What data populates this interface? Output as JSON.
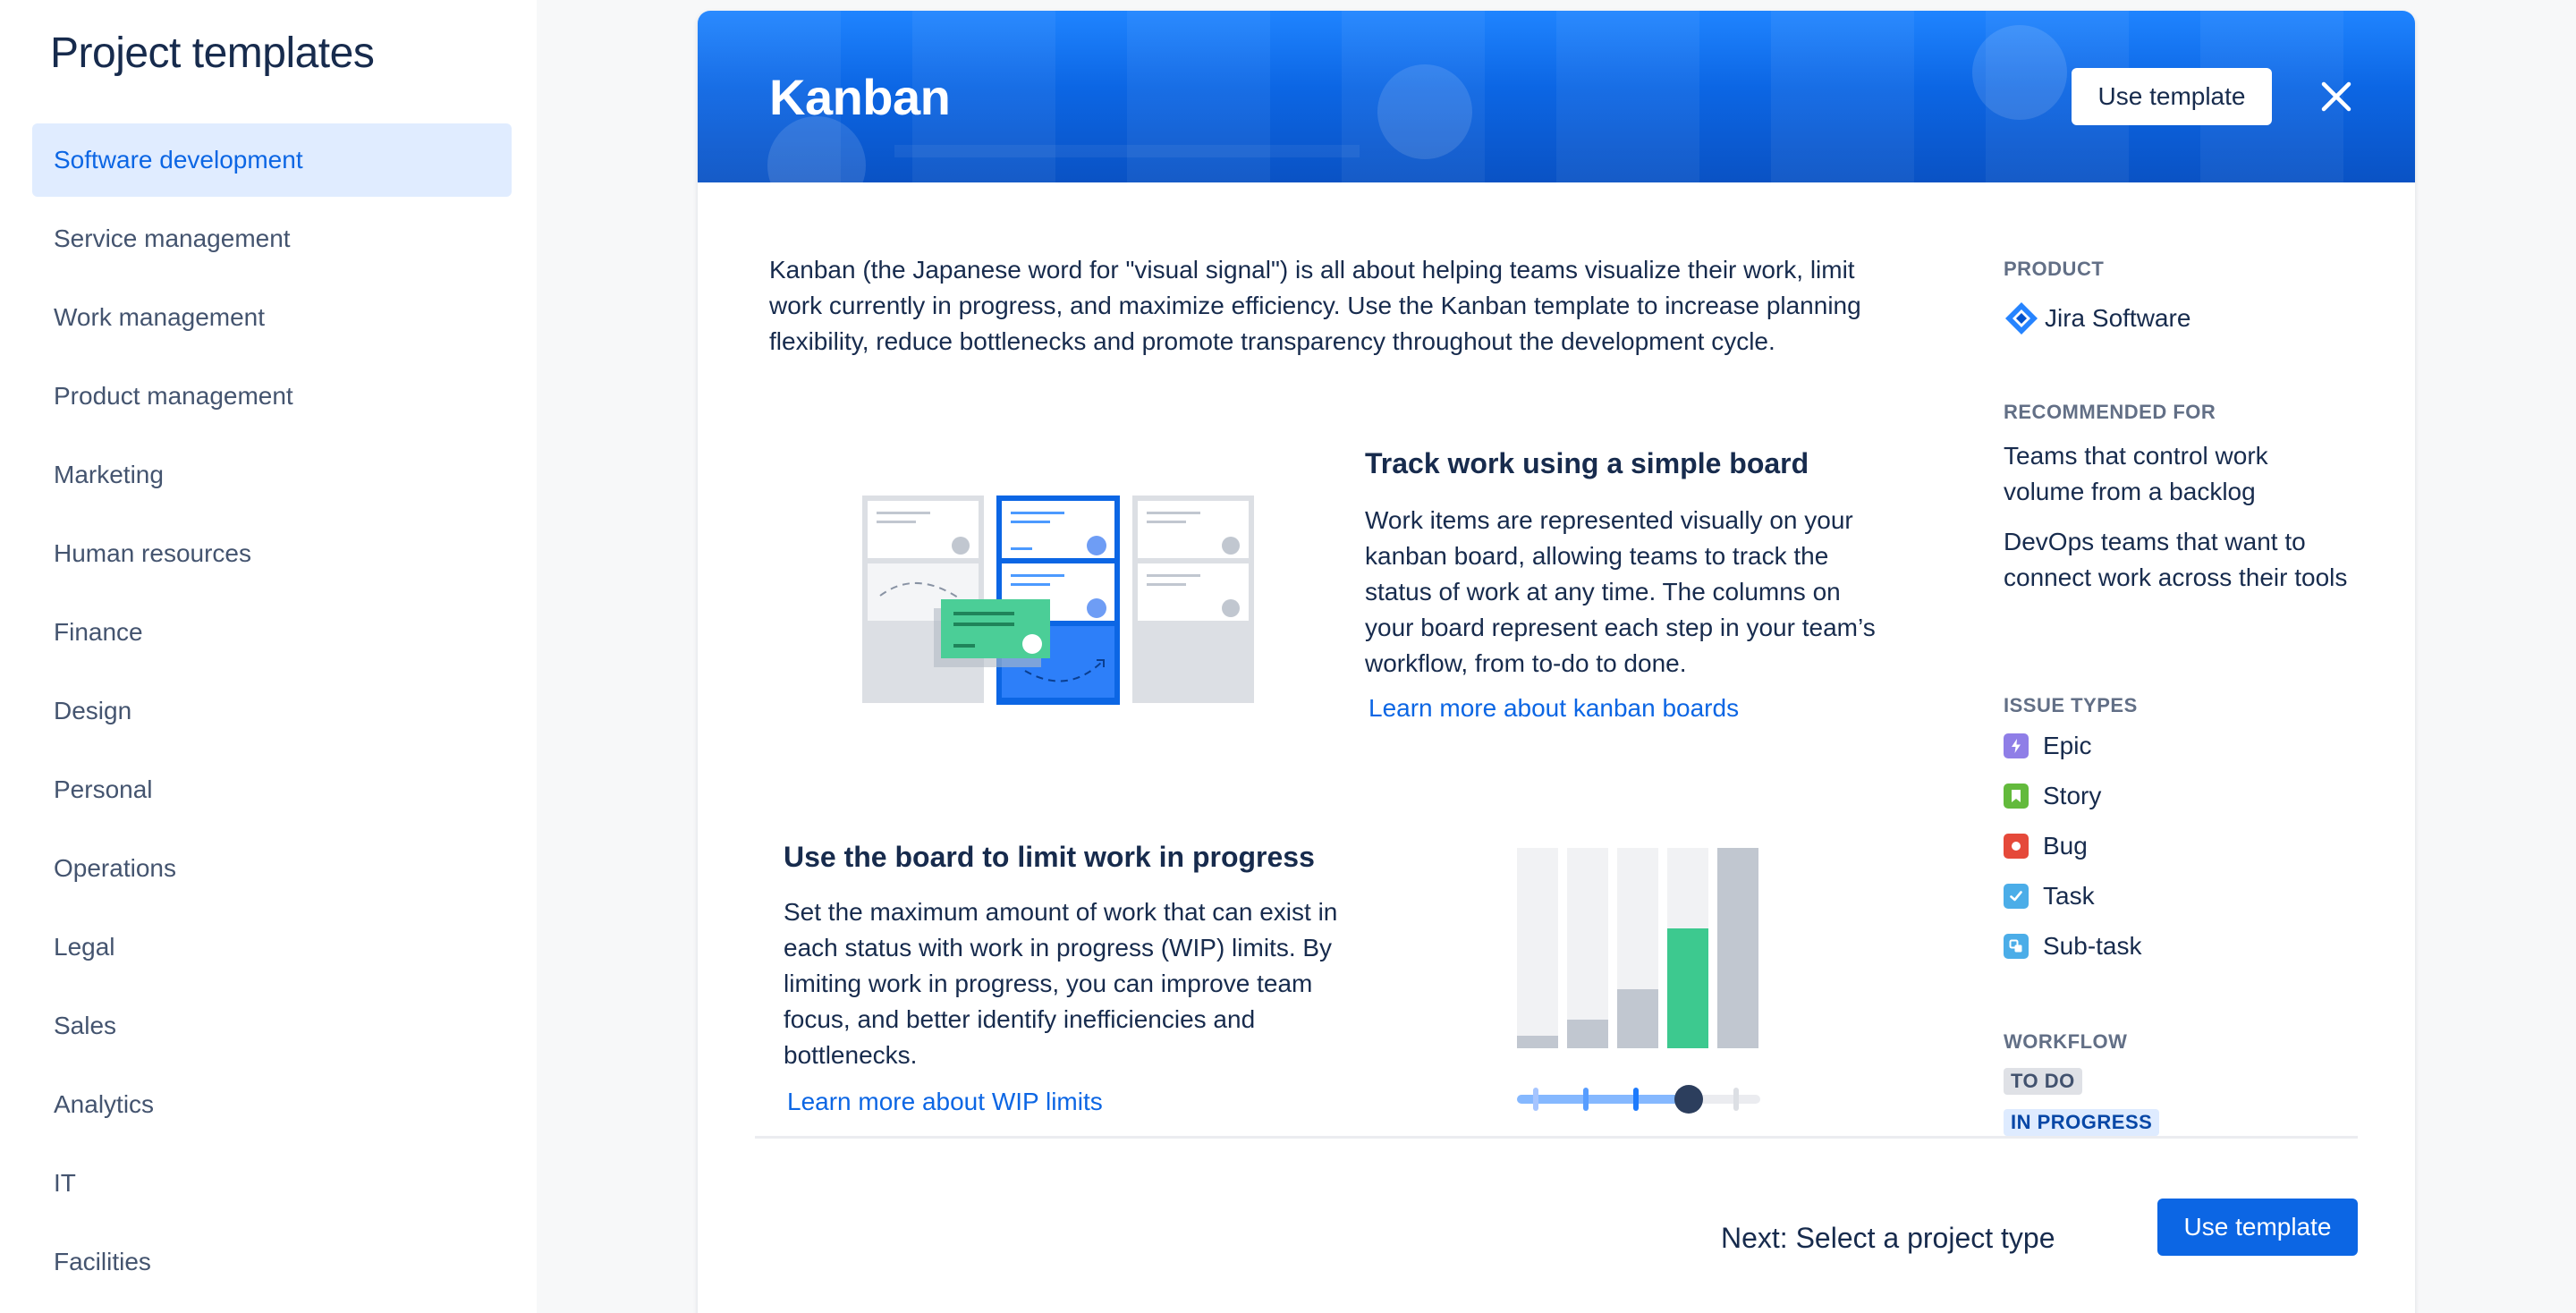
{
  "sidebar": {
    "title": "Project templates",
    "items": [
      {
        "label": "Software development",
        "active": true
      },
      {
        "label": "Service management"
      },
      {
        "label": "Work management"
      },
      {
        "label": "Product management"
      },
      {
        "label": "Marketing"
      },
      {
        "label": "Human resources"
      },
      {
        "label": "Finance"
      },
      {
        "label": "Design"
      },
      {
        "label": "Personal"
      },
      {
        "label": "Operations"
      },
      {
        "label": "Legal"
      },
      {
        "label": "Sales"
      },
      {
        "label": "Analytics"
      },
      {
        "label": "IT"
      },
      {
        "label": "Facilities"
      }
    ]
  },
  "template": {
    "title": "Kanban",
    "use_label": "Use template",
    "close_icon": "close-icon",
    "intro": "Kanban (the Japanese word for \"visual signal\") is all about helping teams visualize their work, limit work currently in progress, and maximize efficiency. Use the Kanban template to increase planning flexibility, reduce bottlenecks and promote transparency throughout the development cycle.",
    "sections": [
      {
        "heading": "Track work using a simple board",
        "body": "Work items are represented visually on your kanban board, allowing teams to track the status of work at any time. The columns on your board represent each step in your team’s workflow, from to-do to done.",
        "link": "Learn more about kanban boards"
      },
      {
        "heading": "Use the board to limit work in progress",
        "body": "Set the maximum amount of work that can exist in each status with work in progress (WIP) limits. By limiting work in progress, you can improve team focus, and better identify inefficiencies and bottlenecks.",
        "link": "Learn more about WIP limits"
      }
    ]
  },
  "meta": {
    "product_label": "PRODUCT",
    "product": "Jira Software",
    "recommended_label": "RECOMMENDED FOR",
    "recommended": [
      "Teams that control work volume from a backlog",
      "DevOps teams that want to connect work across their tools"
    ],
    "issue_types_label": "ISSUE TYPES",
    "issue_types": [
      {
        "name": "Epic",
        "color": "#8F7EE7",
        "icon": "epic-icon"
      },
      {
        "name": "Story",
        "color": "#63BA3C",
        "icon": "story-icon"
      },
      {
        "name": "Bug",
        "color": "#E5493A",
        "icon": "bug-icon"
      },
      {
        "name": "Task",
        "color": "#4BADE8",
        "icon": "task-icon"
      },
      {
        "name": "Sub-task",
        "color": "#4BADE8",
        "icon": "subtask-icon"
      }
    ],
    "workflow_label": "WORKFLOW",
    "workflow": [
      "TO DO",
      "IN PROGRESS"
    ]
  },
  "footer": {
    "next_text": "Next: Select a project type",
    "use_label": "Use template"
  },
  "colors": {
    "brand": "#0C66E4",
    "active_bg": "#E0ECFF",
    "text": "#172B4D",
    "subtle": "#44546F"
  }
}
